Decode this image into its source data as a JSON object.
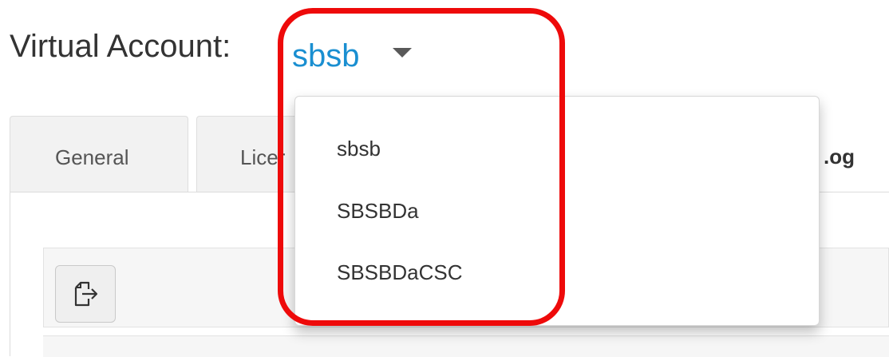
{
  "header": {
    "label": "Virtual Account:",
    "selected_account": "sbsb"
  },
  "tabs": [
    {
      "label": "General"
    },
    {
      "label": "Licer"
    },
    {
      "label": ".og"
    }
  ],
  "dropdown": {
    "options": [
      "sbsb",
      "SBSBDa",
      "SBSBDaCSC"
    ]
  },
  "colors": {
    "link": "#1a8fd1",
    "highlight": "#ee0a0a",
    "tab_bg": "#f2f2f2",
    "text": "#333333"
  },
  "icons": {
    "caret": "caret-down-icon",
    "export": "export-icon"
  }
}
